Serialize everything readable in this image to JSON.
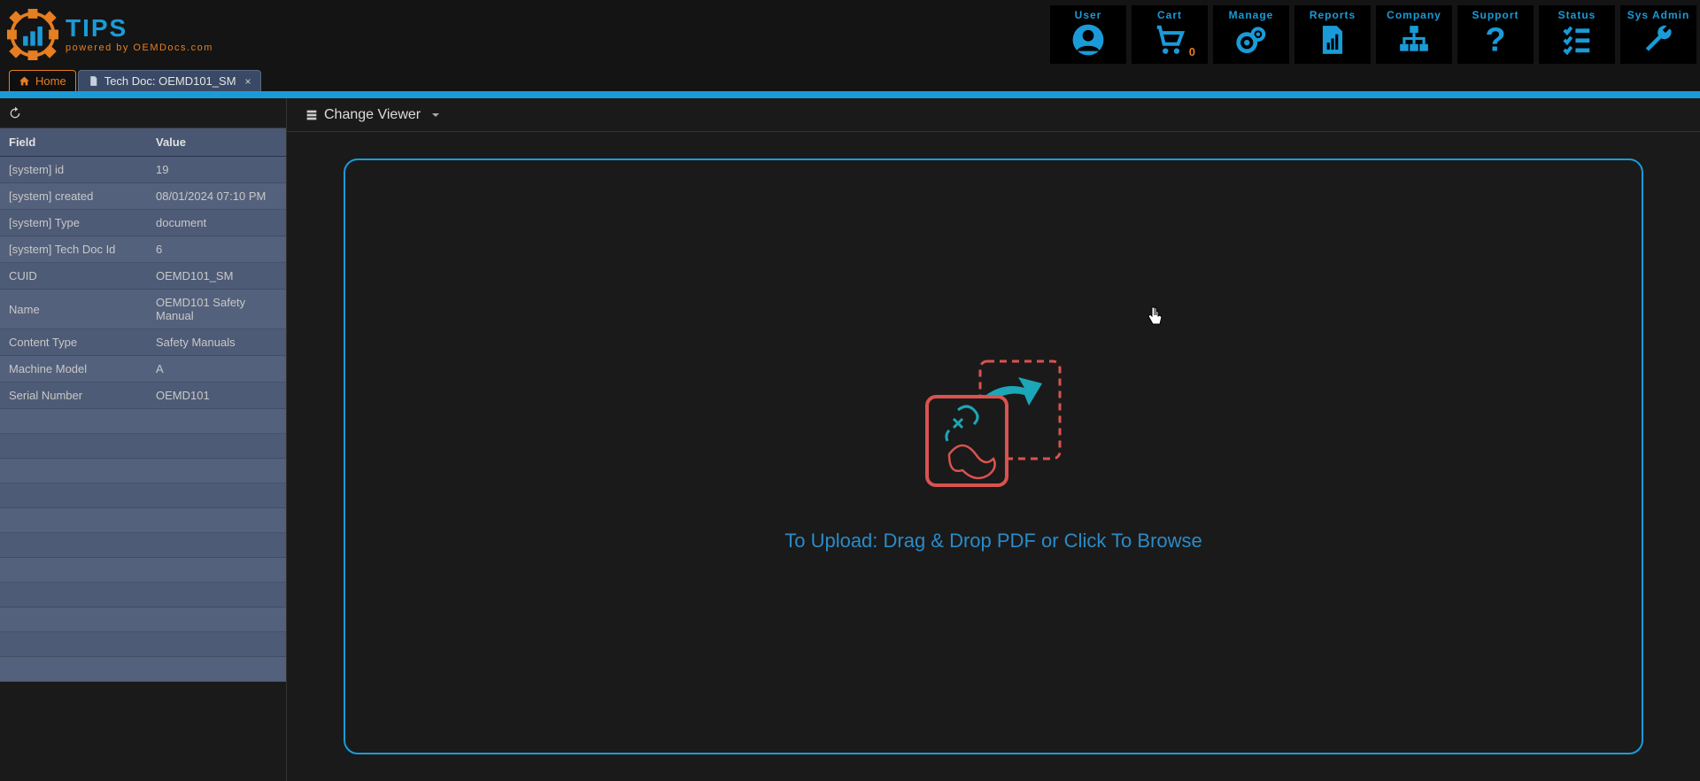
{
  "brand": {
    "title": "TIPS",
    "subtitle": "powered by OEMDocs.com"
  },
  "nav": [
    {
      "id": "user",
      "label": "User"
    },
    {
      "id": "cart",
      "label": "Cart",
      "count": "0"
    },
    {
      "id": "manage",
      "label": "Manage"
    },
    {
      "id": "reports",
      "label": "Reports"
    },
    {
      "id": "company",
      "label": "Company"
    },
    {
      "id": "support",
      "label": "Support"
    },
    {
      "id": "status",
      "label": "Status"
    },
    {
      "id": "sysadmin",
      "label": "Sys Admin"
    }
  ],
  "tabs": {
    "home": "Home",
    "doc": "Tech Doc: OEMD101_SM"
  },
  "sidebar": {
    "headers": {
      "field": "Field",
      "value": "Value"
    },
    "rows": [
      {
        "field": "[system] id",
        "value": "19"
      },
      {
        "field": "[system] created",
        "value": "08/01/2024 07:10 PM"
      },
      {
        "field": "[system] Type",
        "value": "document"
      },
      {
        "field": "[system] Tech Doc Id",
        "value": "6"
      },
      {
        "field": "CUID",
        "value": "OEMD101_SM"
      },
      {
        "field": "Name",
        "value": "OEMD101 Safety Manual"
      },
      {
        "field": "Content Type",
        "value": "Safety Manuals"
      },
      {
        "field": "Machine Model",
        "value": "A"
      },
      {
        "field": "Serial Number",
        "value": "OEMD101"
      },
      {
        "field": "",
        "value": ""
      },
      {
        "field": "",
        "value": ""
      },
      {
        "field": "",
        "value": ""
      },
      {
        "field": "",
        "value": ""
      },
      {
        "field": "",
        "value": ""
      },
      {
        "field": "",
        "value": ""
      },
      {
        "field": "",
        "value": ""
      },
      {
        "field": "",
        "value": ""
      },
      {
        "field": "",
        "value": ""
      },
      {
        "field": "",
        "value": ""
      },
      {
        "field": "",
        "value": ""
      }
    ]
  },
  "main": {
    "change_viewer": "Change Viewer",
    "drop_text": "To Upload: Drag & Drop PDF or Click To Browse"
  }
}
